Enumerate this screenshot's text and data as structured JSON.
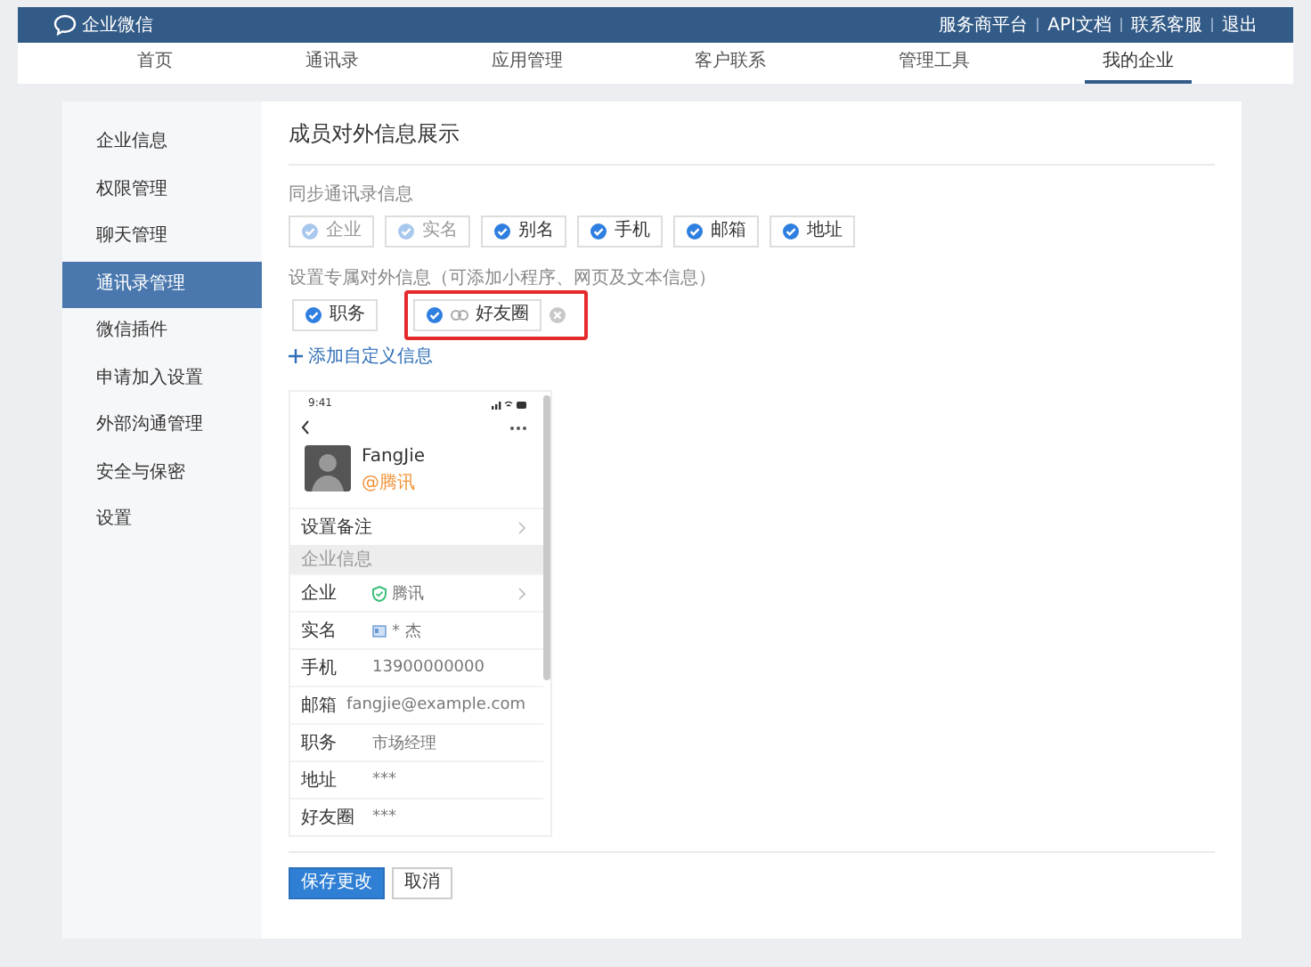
{
  "top_bar": {
    "logo": "企业微信",
    "links": [
      "服务商平台",
      "API文档",
      "联系客服",
      "退出"
    ]
  },
  "nav": [
    {
      "label": "首页",
      "selected": false
    },
    {
      "label": "通讯录",
      "selected": false
    },
    {
      "label": "应用管理",
      "selected": false
    },
    {
      "label": "客户联系",
      "selected": false
    },
    {
      "label": "管理工具",
      "selected": false
    },
    {
      "label": "我的企业",
      "selected": true
    }
  ],
  "sidebar": [
    {
      "label": "企业信息",
      "selected": false
    },
    {
      "label": "权限管理",
      "selected": false
    },
    {
      "label": "聊天管理",
      "selected": false
    },
    {
      "label": "通讯录管理",
      "selected": true
    },
    {
      "label": "微信插件",
      "selected": false
    },
    {
      "label": "申请加入设置",
      "selected": false
    },
    {
      "label": "外部沟通管理",
      "selected": false
    },
    {
      "label": "安全与保密",
      "selected": false
    },
    {
      "label": "设置",
      "selected": false
    }
  ],
  "page_title": "成员对外信息展示",
  "sync": {
    "label": "同步通讯录信息",
    "fields": [
      {
        "label": "企业",
        "checked": true,
        "disabled": true
      },
      {
        "label": "实名",
        "checked": true,
        "disabled": true
      },
      {
        "label": "别名",
        "checked": true,
        "disabled": false
      },
      {
        "label": "手机",
        "checked": true,
        "disabled": false
      },
      {
        "label": "邮箱",
        "checked": true,
        "disabled": false
      },
      {
        "label": "地址",
        "checked": true,
        "disabled": false
      }
    ]
  },
  "custom": {
    "label": "设置专属对外信息（可添加小程序、网页及文本信息）",
    "fields": [
      {
        "kind": "text",
        "label": "职务",
        "checked": true,
        "highlighted": false
      },
      {
        "kind": "link",
        "label": "好友圈",
        "checked": true,
        "highlighted": true
      }
    ],
    "add_link": "添加自定义信息"
  },
  "phone": {
    "time": "9:41",
    "name": "FangJie",
    "company": "@腾讯",
    "remark": "设置备注",
    "section": "企业信息",
    "rows": [
      {
        "kind": "verified",
        "label": "企业",
        "value": "腾讯",
        "chevron": true
      },
      {
        "kind": "id",
        "label": "实名",
        "value": "* 杰",
        "chevron": false
      },
      {
        "kind": "text",
        "label": "手机",
        "value": "13900000000",
        "chevron": false
      },
      {
        "kind": "text",
        "label": "邮箱",
        "value": "fangjie@example.com",
        "chevron": false
      },
      {
        "kind": "text",
        "label": "职务",
        "value": "市场经理",
        "chevron": false
      },
      {
        "kind": "text",
        "label": "地址",
        "value": "***",
        "chevron": false
      },
      {
        "kind": "text",
        "label": "好友圈",
        "value": "***",
        "chevron": false
      }
    ]
  },
  "buttons": {
    "save": "保存更改",
    "cancel": "取消"
  }
}
